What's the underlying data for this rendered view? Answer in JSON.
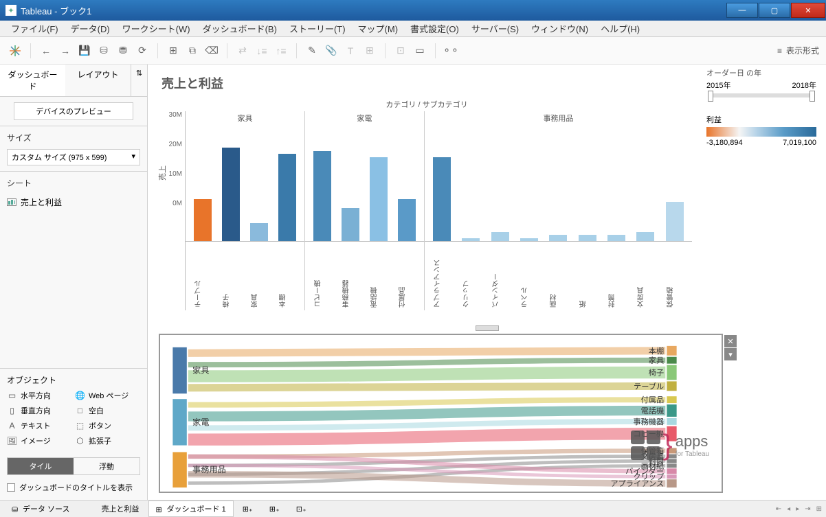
{
  "window": {
    "title": "Tableau - ブック1"
  },
  "menu": [
    "ファイル(F)",
    "データ(D)",
    "ワークシート(W)",
    "ダッシュボード(B)",
    "ストーリー(T)",
    "マップ(M)",
    "書式設定(O)",
    "サーバー(S)",
    "ウィンドウ(N)",
    "ヘルプ(H)"
  ],
  "toolbar": {
    "show_me": "表示形式"
  },
  "sidebar": {
    "tabs": [
      "ダッシュボード",
      "レイアウト"
    ],
    "preview": "デバイスのプレビュー",
    "size_label": "サイズ",
    "size_value": "カスタム サイズ (975 x 599)",
    "sheets_label": "シート",
    "sheet0": "売上と利益",
    "objects_label": "オブジェクト",
    "objects": {
      "h": "水平方向",
      "v": "垂直方向",
      "t": "テキスト",
      "i": "イメージ",
      "w": "Web ページ",
      "b": "空白",
      "btn": "ボタン",
      "ext": "拡張子"
    },
    "tile": "タイル",
    "float": "浮動",
    "show_title": "ダッシュボードのタイトルを表示"
  },
  "dashboard": {
    "title": "売上と利益",
    "year_filter": {
      "label": "オーダー日 の年",
      "start": "2015年",
      "end": "2018年"
    },
    "profit_legend": {
      "label": "利益",
      "min": "-3,180,894",
      "max": "7,019,100"
    }
  },
  "chart_data": {
    "type": "bar",
    "title": "カテゴリ / サブカテゴリ",
    "ylabel": "売上",
    "yticks": [
      "0M",
      "10M",
      "20M",
      "30M"
    ],
    "ymax": 32,
    "categories": [
      {
        "name": "家具",
        "bars": [
          {
            "label": "テーブル",
            "value": 14,
            "color": "#e8742a"
          },
          {
            "label": "椅子",
            "value": 31,
            "color": "#2a5a8a"
          },
          {
            "label": "家具",
            "value": 6,
            "color": "#8abadc"
          },
          {
            "label": "本棚",
            "value": 29,
            "color": "#3a7aaa"
          }
        ]
      },
      {
        "name": "家電",
        "bars": [
          {
            "label": "コピー機",
            "value": 30,
            "color": "#4a8ab8"
          },
          {
            "label": "事務機器",
            "value": 11,
            "color": "#7ab0d4"
          },
          {
            "label": "電話機",
            "value": 28,
            "color": "#8ac0e4"
          },
          {
            "label": "付属品",
            "value": 14,
            "color": "#5a9ac8"
          }
        ]
      },
      {
        "name": "事務用品",
        "bars": [
          {
            "label": "アプライアンス",
            "value": 28,
            "color": "#4a8ab8"
          },
          {
            "label": "クリップ",
            "value": 1,
            "color": "#a8d0e8"
          },
          {
            "label": "バインダー",
            "value": 3,
            "color": "#a8d0e8"
          },
          {
            "label": "ラベル",
            "value": 1,
            "color": "#a8d0e8"
          },
          {
            "label": "画材",
            "value": 2,
            "color": "#a8d0e8"
          },
          {
            "label": "紙",
            "value": 2,
            "color": "#a8d0e8"
          },
          {
            "label": "封筒",
            "value": 2,
            "color": "#a8d0e8"
          },
          {
            "label": "文房具",
            "value": 3,
            "color": "#a8d0e8"
          },
          {
            "label": "保管箱",
            "value": 13,
            "color": "#b8d8ec"
          }
        ]
      }
    ]
  },
  "sankey": {
    "left": [
      {
        "name": "家具",
        "y": 18,
        "h": 68,
        "color": "#4a7aaa"
      },
      {
        "name": "家電",
        "y": 94,
        "h": 68,
        "color": "#5fa8c8"
      },
      {
        "name": "事務用品",
        "y": 172,
        "h": 52,
        "color": "#e8a03a"
      }
    ],
    "right": [
      {
        "name": "本棚",
        "color": "#e8a860",
        "y": 16,
        "h": 14
      },
      {
        "name": "家具",
        "color": "#4a8a4a",
        "y": 32,
        "h": 10
      },
      {
        "name": "椅子",
        "color": "#8ac878",
        "y": 44,
        "h": 22
      },
      {
        "name": "テーブル",
        "color": "#c0b040",
        "y": 68,
        "h": 14
      },
      {
        "name": "付属品",
        "color": "#d8c850",
        "y": 90,
        "h": 10
      },
      {
        "name": "電話機",
        "color": "#3a9888",
        "y": 102,
        "h": 18
      },
      {
        "name": "事務機器",
        "color": "#a8d8e0",
        "y": 122,
        "h": 10
      },
      {
        "name": "コピー機",
        "color": "#e85a6a",
        "y": 134,
        "h": 22
      },
      {
        "name": "保管箱",
        "color": "#c89878",
        "y": 166,
        "h": 8
      },
      {
        "name": "文房具",
        "color": "#888",
        "y": 175,
        "h": 6
      },
      {
        "name": "封筒",
        "color": "#888",
        "y": 182,
        "h": 6
      },
      {
        "name": "画材紙",
        "color": "#888",
        "y": 189,
        "h": 6
      },
      {
        "name": "バインダー",
        "color": "#d888a8",
        "y": 196,
        "h": 8
      },
      {
        "name": "クリップ",
        "color": "#d898b8",
        "y": 205,
        "h": 6
      },
      {
        "name": "アプライアンス",
        "color": "#b89888",
        "y": 212,
        "h": 12
      }
    ]
  },
  "watermark": {
    "text": "apps",
    "sub": "for Tableau"
  },
  "bottom": {
    "datasource": "データ ソース",
    "tab0": "売上と利益",
    "tab1": "ダッシュボード 1"
  }
}
